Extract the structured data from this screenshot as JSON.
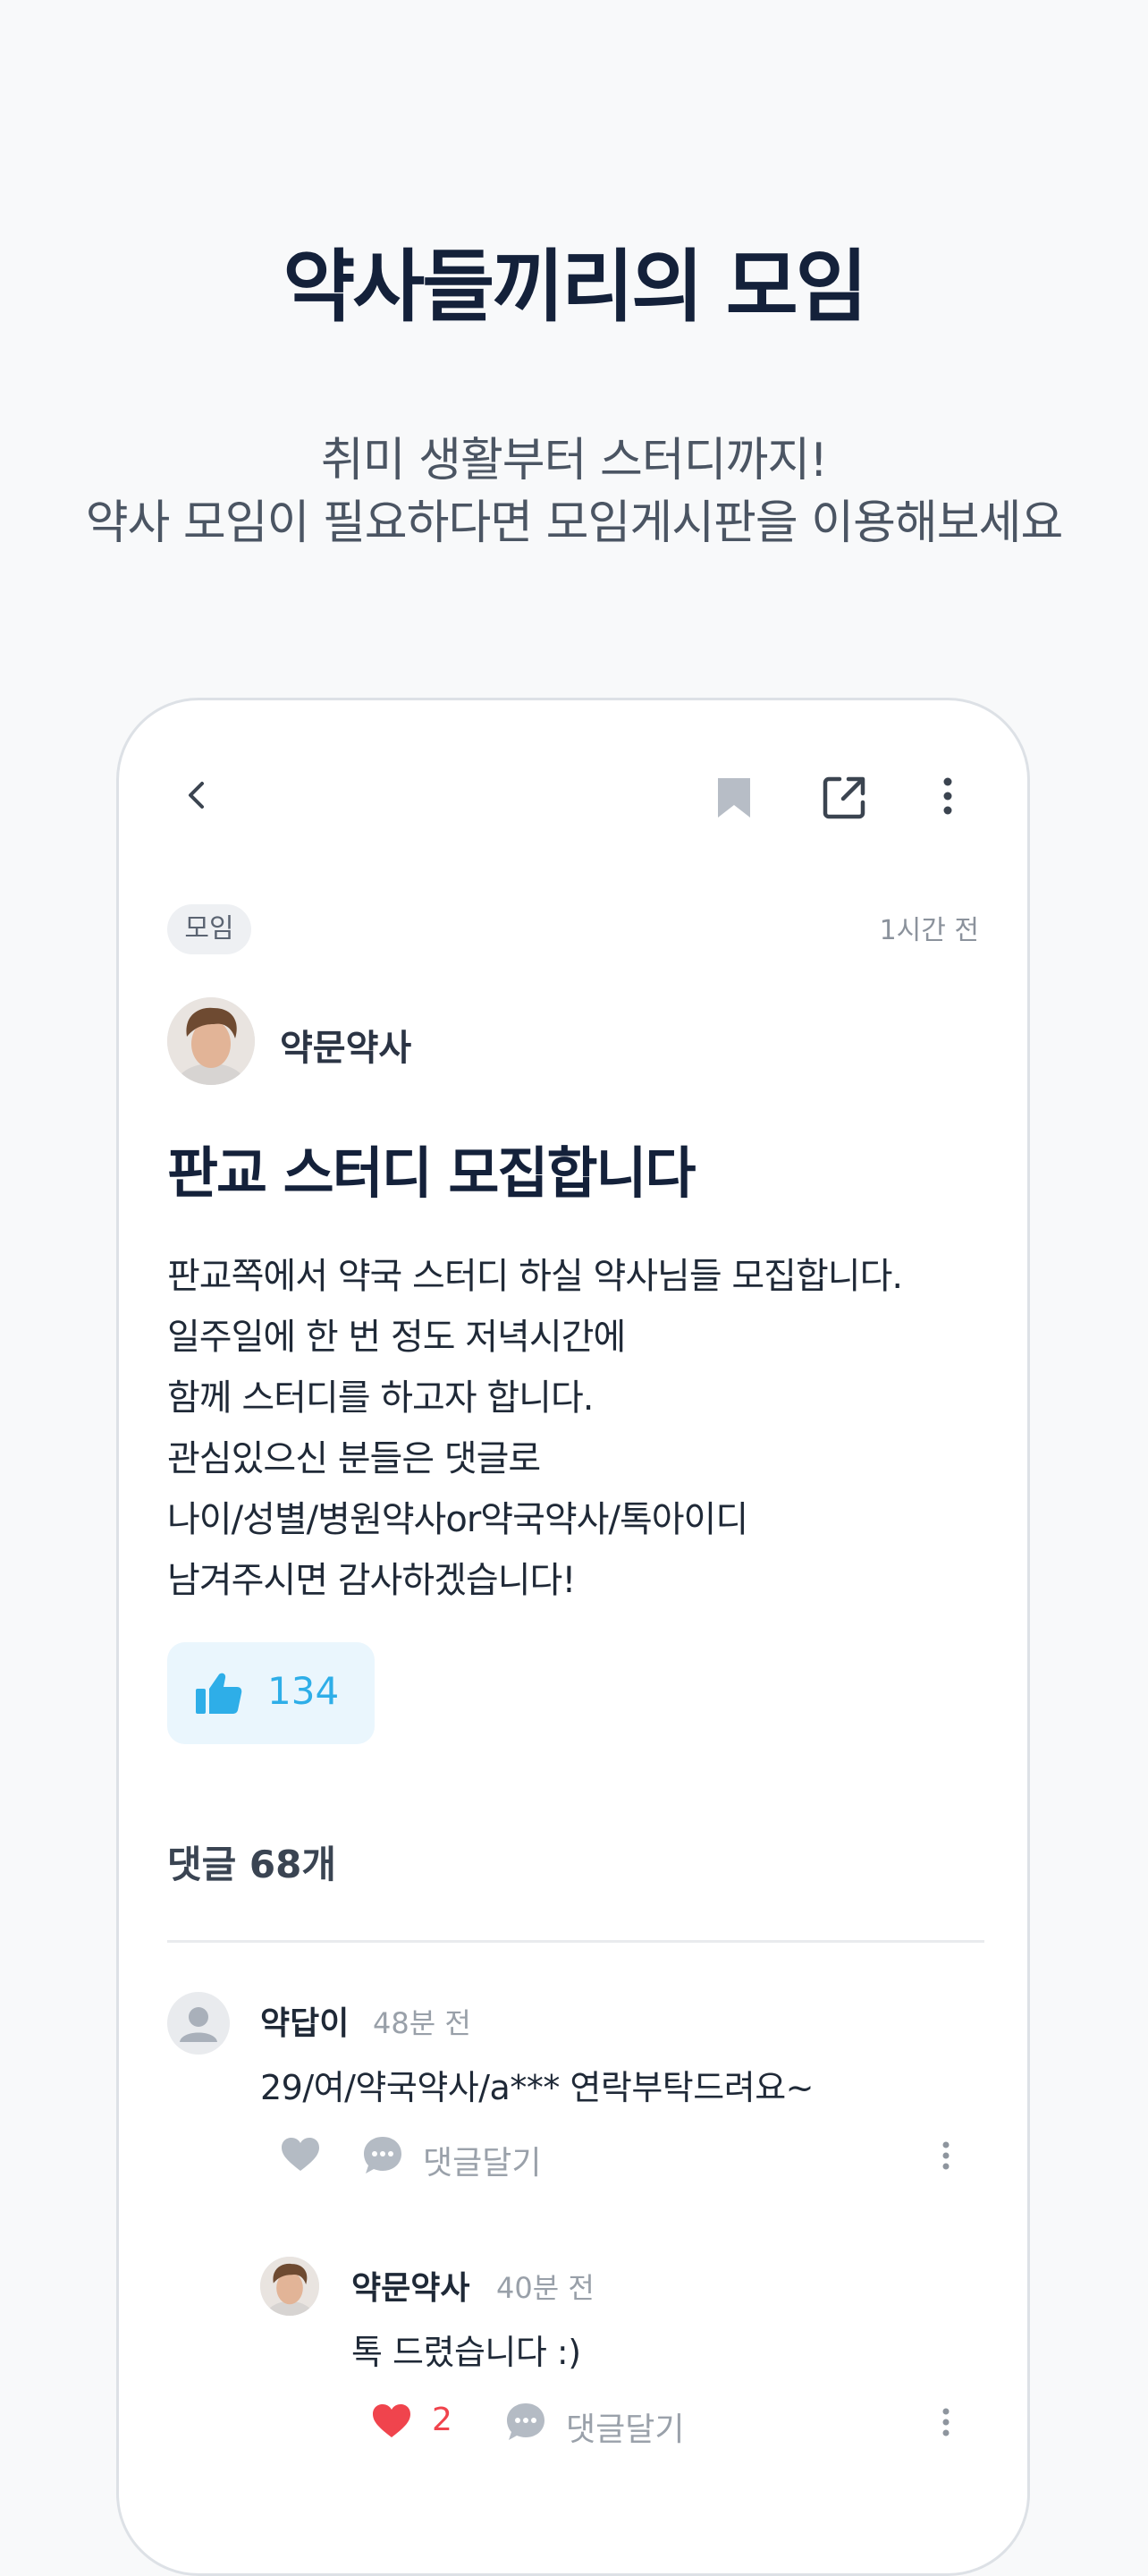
{
  "hero": {
    "title": "약사들끼리의 모임",
    "subtitle_line1": "취미 생활부터 스터디까지!",
    "subtitle_line2": "약사 모임이 필요하다면 모임게시판을 이용해보세요"
  },
  "post": {
    "category": "모임",
    "time": "1시간 전",
    "author": "약문약사",
    "title": "판교 스터디 모집합니다",
    "body": [
      "판교쪽에서 약국 스터디 하실 약사님들 모집합니다.",
      "일주일에 한 번 정도 저녁시간에",
      "함께 스터디를 하고자 합니다.",
      "관심있으신 분들은 댓글로",
      "나이/성별/병원약사or약국약사/톡아이디",
      "남겨주시면 감사하겠습니다!"
    ],
    "likes": "134"
  },
  "comments_header": "댓글 68개",
  "comments": [
    {
      "author": "약답이",
      "time": "48분 전",
      "text": "29/여/약국약사/a*** 연락부탁드려요~",
      "reply_label": "댓글달기"
    },
    {
      "author": "약문약사",
      "time": "40분 전",
      "text": "톡 드렸습니다 :)",
      "likes": "2",
      "reply_label": "댓글달기"
    }
  ],
  "colors": {
    "accent_blue": "#2eaee8",
    "like_bg": "#eaf6fd",
    "heart_red": "#f0444d",
    "title_navy": "#14213a"
  },
  "icons": [
    "back-icon",
    "bookmark-icon",
    "share-icon",
    "more-icon",
    "thumbs-up-icon",
    "heart-icon",
    "comment-bubble-icon",
    "user-icon"
  ]
}
